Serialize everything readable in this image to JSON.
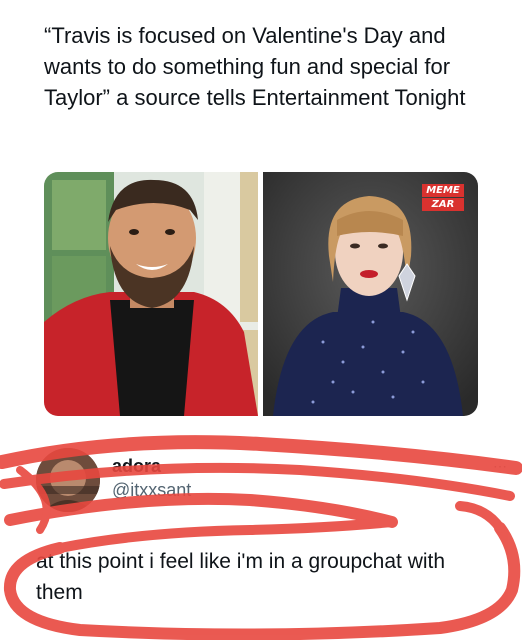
{
  "post": {
    "text": "“Travis is focused on Valentine's Day and wants to do something fun and special for Taylor” a source tells Entertainment Tonight",
    "watermark_line1": "MEME",
    "watermark_line2": "ZAR"
  },
  "reply": {
    "display_name": "adora",
    "handle": "@itxxsant",
    "text": "at this point i feel like i'm in a groupchat with them",
    "more_icon": "⋯"
  },
  "colors": {
    "scribble": "#e8483f",
    "badge": "#d9322f",
    "handle": "#536471"
  },
  "icons": {
    "more": "more-options-icon"
  }
}
